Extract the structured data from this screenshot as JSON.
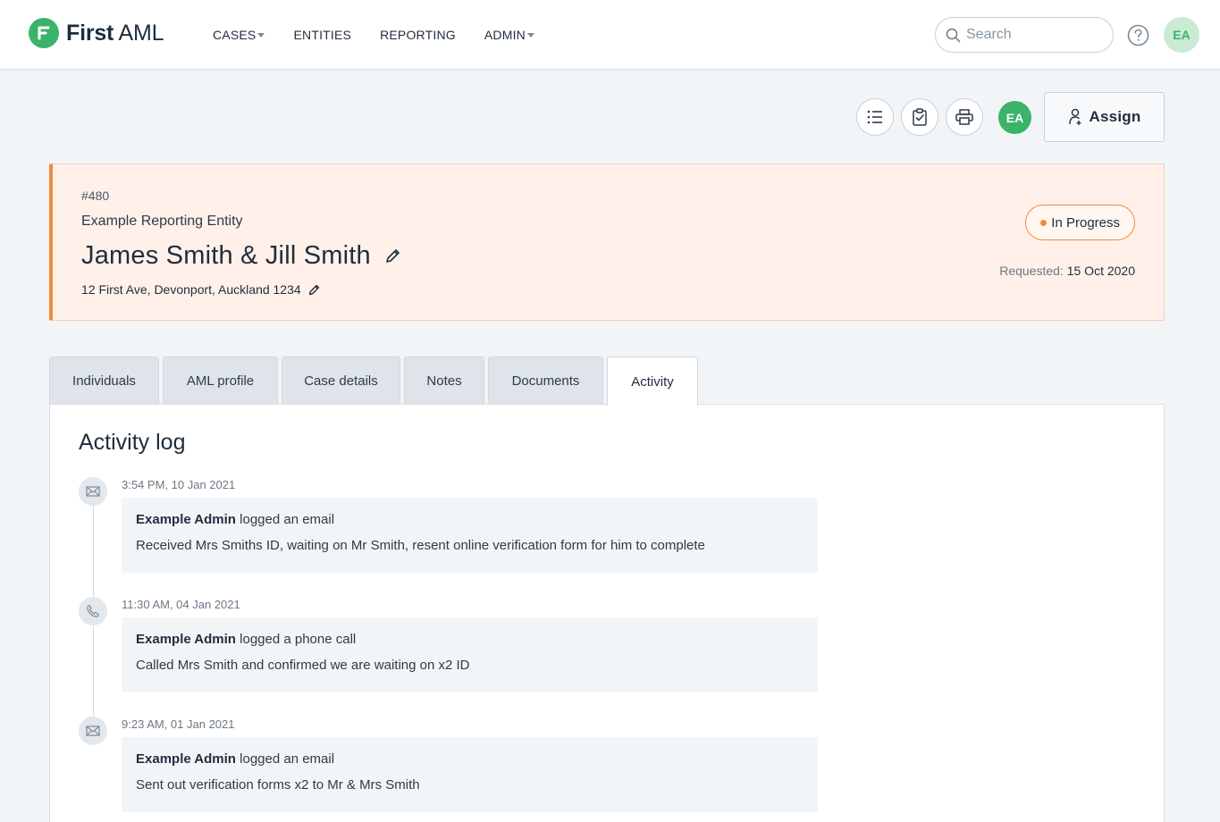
{
  "brand": {
    "name_bold": "First",
    "name_rest": " AML"
  },
  "nav": {
    "items": [
      {
        "label": "CASES",
        "dropdown": true
      },
      {
        "label": "ENTITIES",
        "dropdown": false
      },
      {
        "label": "REPORTING",
        "dropdown": false
      },
      {
        "label": "ADMIN",
        "dropdown": true
      }
    ]
  },
  "search": {
    "placeholder": "Search"
  },
  "user": {
    "initials": "EA"
  },
  "toolbar": {
    "icons": [
      "list-icon",
      "clipboard-check-icon",
      "printer-icon"
    ],
    "owner_initials": "EA",
    "assign_label": "Assign"
  },
  "case": {
    "number": "#480",
    "entity": "Example Reporting Entity",
    "title": "James Smith & Jill Smith",
    "address": "12 First Ave, Devonport, Auckland 1234",
    "status": "In Progress",
    "requested_label": "Requested:",
    "requested_date": "15 Oct 2020"
  },
  "tabs": [
    {
      "label": "Individuals",
      "active": false
    },
    {
      "label": "AML profile",
      "active": false
    },
    {
      "label": "Case details",
      "active": false
    },
    {
      "label": "Notes",
      "active": false
    },
    {
      "label": "Documents",
      "active": false
    },
    {
      "label": "Activity",
      "active": true
    }
  ],
  "activity": {
    "title": "Activity log",
    "entries": [
      {
        "type": "email",
        "time": "3:54 PM, 10 Jan 2021",
        "actor": "Example Admin",
        "action": " logged an email",
        "text": "Received Mrs Smiths ID, waiting on Mr Smith, resent online verification form for him to complete"
      },
      {
        "type": "phone",
        "time": "11:30 AM, 04 Jan 2021",
        "actor": "Example Admin",
        "action": " logged a phone call",
        "text": "Called Mrs Smith and confirmed we are waiting on x2 ID"
      },
      {
        "type": "email",
        "time": "9:23 AM, 01 Jan 2021",
        "actor": "Example Admin",
        "action": " logged an email",
        "text": "Sent out verification forms x2 to Mr & Mrs Smith"
      }
    ]
  },
  "colors": {
    "brand_green": "#3bb36b",
    "accent_orange": "#f28a3b",
    "header_bg": "#fff1e9"
  }
}
